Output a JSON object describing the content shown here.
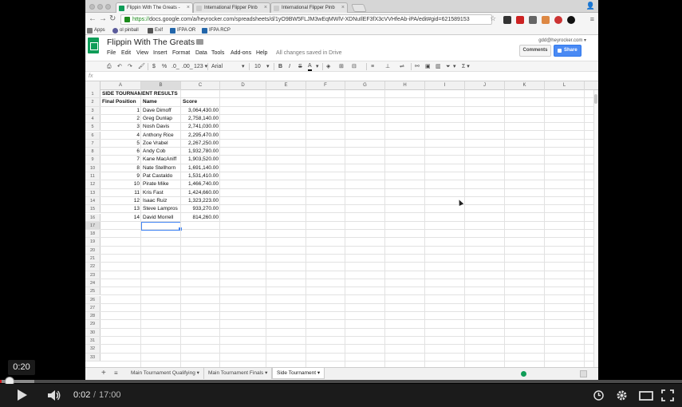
{
  "browser": {
    "tabs": [
      {
        "label": "Flippin With The Greats - ",
        "active": true
      },
      {
        "label": "International Flipper Pinb",
        "active": false
      },
      {
        "label": "International Flipper Pinb",
        "active": false
      }
    ],
    "url_scheme": "https://",
    "url_rest": "docs.google.com/a/heyrocker.com/spreadsheets/d/1yO9BW5FLJM3wEqMWlV-XDNuIlEF3fX3cVVHfeAb-iPA/edit#gid=621589153",
    "bookmarks": [
      {
        "label": "Apps",
        "color": "#777777"
      },
      {
        "label": "ol pinball",
        "color": "#5b5b9b"
      },
      {
        "label": "Exif",
        "color": "#555555"
      },
      {
        "label": "IFPA OR",
        "color": "#2266aa"
      },
      {
        "label": "IFPA RCP",
        "color": "#2266aa"
      }
    ]
  },
  "docs": {
    "title": "Flippin With The Greats",
    "menu": [
      "File",
      "Edit",
      "View",
      "Insert",
      "Format",
      "Data",
      "Tools",
      "Add-ons",
      "Help"
    ],
    "save_status": "All changes saved in Drive",
    "user_email": "gdd@heyrocker.com ▾",
    "comments_label": "Comments",
    "share_label": "Share",
    "toolbar": {
      "currency": "$",
      "percent": "%",
      "dec_less": ".0_",
      "dec_more": ".00_",
      "number_format": "123 ▾",
      "font": "Arial",
      "font_dropdown": "▾",
      "font_size": "10",
      "font_size_dropdown": "▾",
      "bold": "B",
      "italic": "I",
      "strike": "S",
      "text_color": "A",
      "functions": "Σ ▾"
    },
    "fx": "fx"
  },
  "sheet": {
    "columns": [
      "A",
      "B",
      "C",
      "D",
      "E",
      "F",
      "G",
      "H",
      "I",
      "J",
      "K",
      "L"
    ],
    "title": "SIDE TOURNAMENT RESULTS",
    "headers": [
      "Final Position",
      "Name",
      "Score"
    ],
    "rows": [
      {
        "pos": "1",
        "name": "Dave Dimoff",
        "score": "3,064,430.00"
      },
      {
        "pos": "2",
        "name": "Greg Dunlap",
        "score": "2,758,140.00"
      },
      {
        "pos": "3",
        "name": "Nosh Davis",
        "score": "2,741,030.00"
      },
      {
        "pos": "4",
        "name": "Anthony Rice",
        "score": "2,295,470.00"
      },
      {
        "pos": "5",
        "name": "Zoe Vrabel",
        "score": "2,267,250.00"
      },
      {
        "pos": "6",
        "name": "Andy Cob",
        "score": "1,932,780.00"
      },
      {
        "pos": "7",
        "name": "Kane MacAniff",
        "score": "1,903,520.00"
      },
      {
        "pos": "8",
        "name": "Nate Stellhorn",
        "score": "1,691,140.00"
      },
      {
        "pos": "9",
        "name": "Pat Castaldo",
        "score": "1,531,410.00"
      },
      {
        "pos": "10",
        "name": "Pirate Mike",
        "score": "1,466,740.00"
      },
      {
        "pos": "11",
        "name": "Kris Fast",
        "score": "1,424,660.00"
      },
      {
        "pos": "12",
        "name": "Isaac Ruiz",
        "score": "1,323,223.00"
      },
      {
        "pos": "13",
        "name": "Steve Lampros",
        "score": "933,270.00"
      },
      {
        "pos": "14",
        "name": "David Morrell",
        "score": "814,260.00"
      }
    ],
    "row_count": 33,
    "selected_cell": "B17",
    "tabs": [
      {
        "label": "Main Tournament Qualifying",
        "active": false
      },
      {
        "label": "Main Tournament Finals",
        "active": false
      },
      {
        "label": "Side Tournament",
        "active": true
      }
    ],
    "add_sheet": "+",
    "sheet_list": "≡",
    "tab_arrow": "▾"
  },
  "player": {
    "preview_time": "0:20",
    "current_time": "0:02",
    "separator": "/",
    "total_time": "17:00",
    "progress_fraction": 0.002,
    "buffered_fraction": 0.05,
    "accent": "#cc181e"
  }
}
